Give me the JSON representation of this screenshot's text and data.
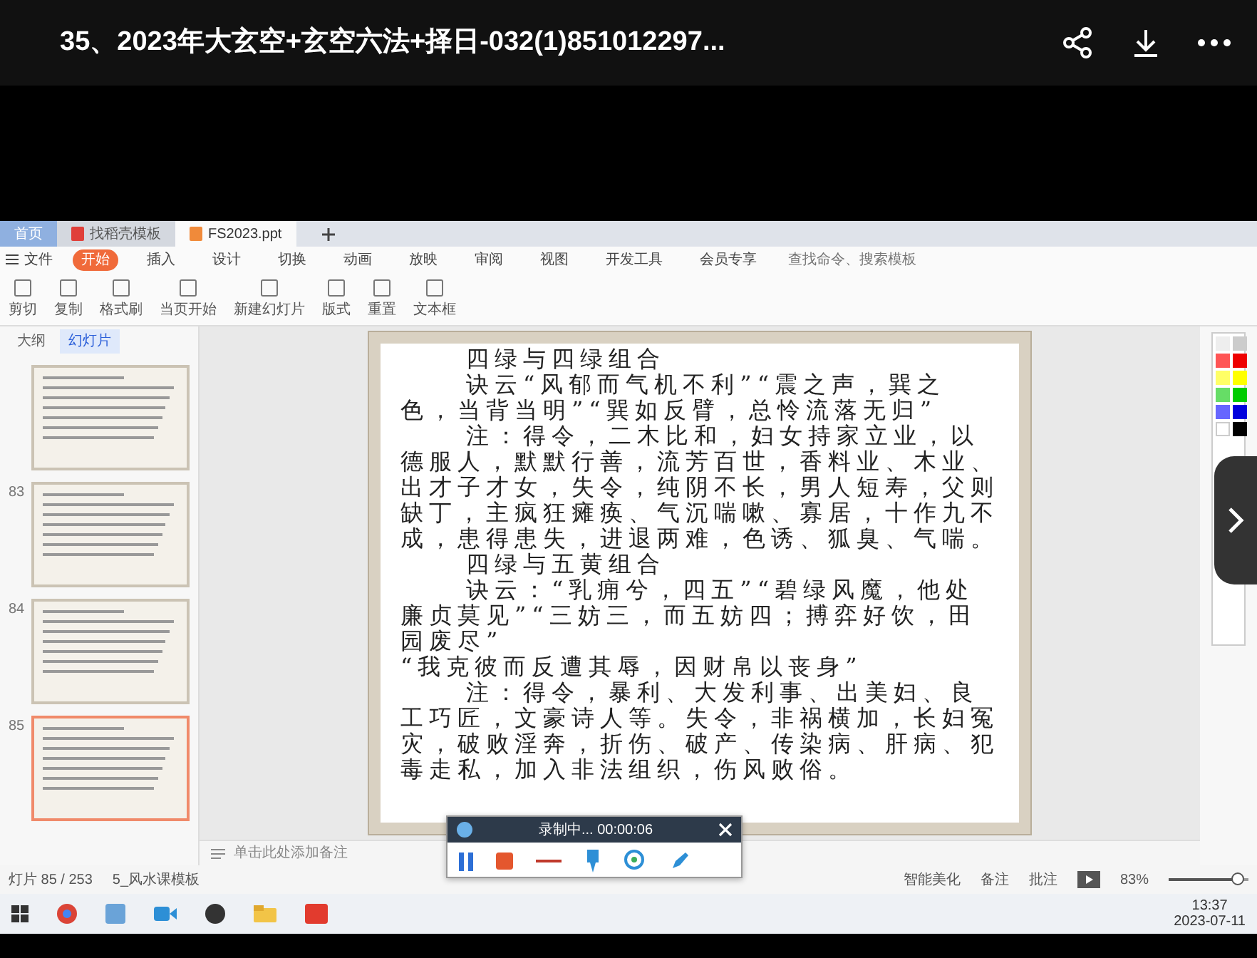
{
  "player": {
    "title": "35、2023年大玄空+玄空六法+择日-032(1)851012297..."
  },
  "app_tabs": [
    {
      "label": "首页",
      "selected": false,
      "kind": "home"
    },
    {
      "label": "找稻壳模板",
      "selected": false,
      "kind": "doc"
    },
    {
      "label": "FS2023.ppt",
      "selected": true,
      "kind": "doc"
    }
  ],
  "menu": {
    "file": "文件",
    "items": [
      {
        "label": "开始",
        "selected": true
      },
      {
        "label": "插入",
        "selected": false
      },
      {
        "label": "设计",
        "selected": false
      },
      {
        "label": "切换",
        "selected": false
      },
      {
        "label": "动画",
        "selected": false
      },
      {
        "label": "放映",
        "selected": false
      },
      {
        "label": "审阅",
        "selected": false
      },
      {
        "label": "视图",
        "selected": false
      },
      {
        "label": "开发工具",
        "selected": false
      },
      {
        "label": "会员专享",
        "selected": false
      }
    ],
    "search_placeholder": "查找命令、搜索模板"
  },
  "ribbon": {
    "tools": [
      "剪切",
      "复制",
      "格式刷",
      "当页开始",
      "新建幻灯片",
      "版式",
      "重置",
      "文本框"
    ]
  },
  "panel_tabs": [
    {
      "label": "大纲",
      "selected": false
    },
    {
      "label": "幻灯片",
      "selected": true
    }
  ],
  "thumbnails": [
    {
      "selected": false
    },
    {
      "number": "83",
      "selected": false
    },
    {
      "number": "84",
      "selected": false
    },
    {
      "number": "85",
      "selected": true
    }
  ],
  "slide": {
    "paragraphs": [
      {
        "kind": "heading",
        "text": "四绿与四绿组合"
      },
      {
        "kind": "body",
        "text": "诀云“风郁而气机不利”“震之声，巽之色，当背当明”“巽如反臂，总怜流落无归”"
      },
      {
        "kind": "body",
        "text": "注：得令，二木比和，妇女持家立业，以德服人，默默行善，流芳百世，香料业、木业、出才子才女，失令，纯阴不长，男人短寿，父则缺丁，主疯狂瘫痪、气沉喘嗽、寡居，十作九不成，患得患失，进退两难，色诱、狐臭、气喘。"
      },
      {
        "kind": "heading",
        "text": "四绿与五黄组合"
      },
      {
        "kind": "body",
        "text": "诀云：“乳痈兮，四五”“碧绿风魔，他处廉贞莫见”“三妨三，而五妨四；搏弈好饮，田园废尽”"
      },
      {
        "kind": "quote",
        "text": "“我克彼而反遭其辱，因财帛以丧身”"
      },
      {
        "kind": "body",
        "text": "注：得令，暴利、大发利事、出美妇、良工巧匠，文豪诗人等。失令，非祸横加，长妇冤灾，破败淫奔，折伤、破产、传染病、肝病、犯毒走私，加入非法组织，伤风败俗。"
      }
    ]
  },
  "notes_placeholder": "单击此处添加备注",
  "recorder": {
    "status": "录制中... 00:00:06"
  },
  "status_bar": {
    "slide_count": "灯片 85 / 253",
    "template": "5_风水课模板",
    "beautify": "智能美化",
    "notes": "备注",
    "comments": "批注",
    "zoom": "83%",
    "level": 0.85
  },
  "taskbar": {
    "time": "13:37",
    "date": "2023-07-11"
  }
}
